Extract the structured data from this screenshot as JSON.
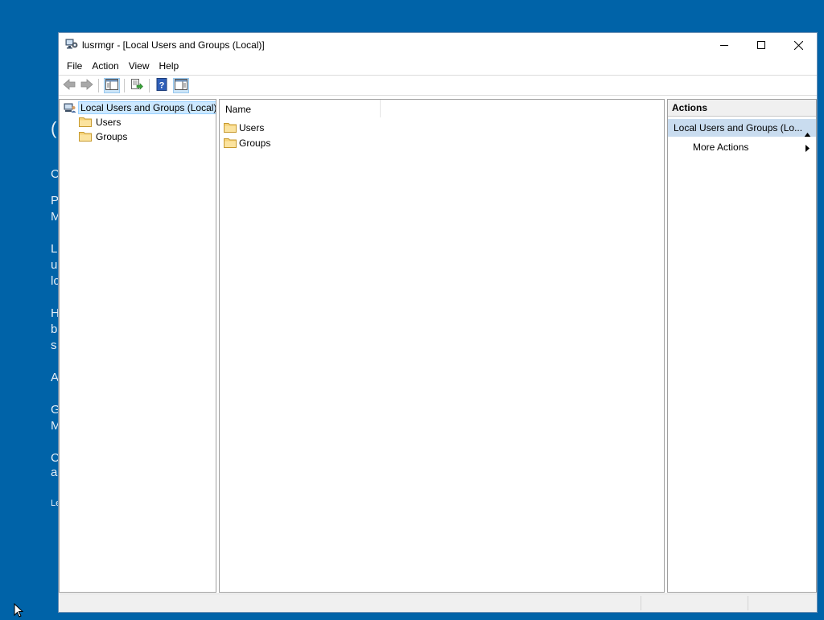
{
  "window": {
    "title": "lusrmgr - [Local Users and Groups (Local)]",
    "controls": {
      "minimize": "minimize",
      "maximize": "maximize",
      "close": "close"
    }
  },
  "menu": [
    "File",
    "Action",
    "View",
    "Help"
  ],
  "toolbar": {
    "buttons": [
      "back-arrow-icon",
      "forward-arrow-icon",
      "show-hide-console-tree-icon",
      "export-list-icon",
      "help-icon",
      "show-hide-action-pane-icon"
    ]
  },
  "tree": {
    "root": "Local Users and Groups (Local)",
    "children": [
      "Users",
      "Groups"
    ]
  },
  "results": {
    "column": "Name",
    "items": [
      "Users",
      "Groups"
    ]
  },
  "actions": {
    "header": "Actions",
    "section": "Local Users and Groups (Lo...",
    "items": [
      "More Actions"
    ]
  },
  "background_fragments": [
    "(",
    "C",
    "P",
    "M",
    "L",
    "u",
    "lo",
    "H",
    "b",
    "s",
    "A",
    "G",
    "M",
    "C",
    "a",
    "Le"
  ],
  "colors": {
    "desktop": "#0063a8",
    "selection": "#cce8ff",
    "action_section": "#c9dcef"
  }
}
